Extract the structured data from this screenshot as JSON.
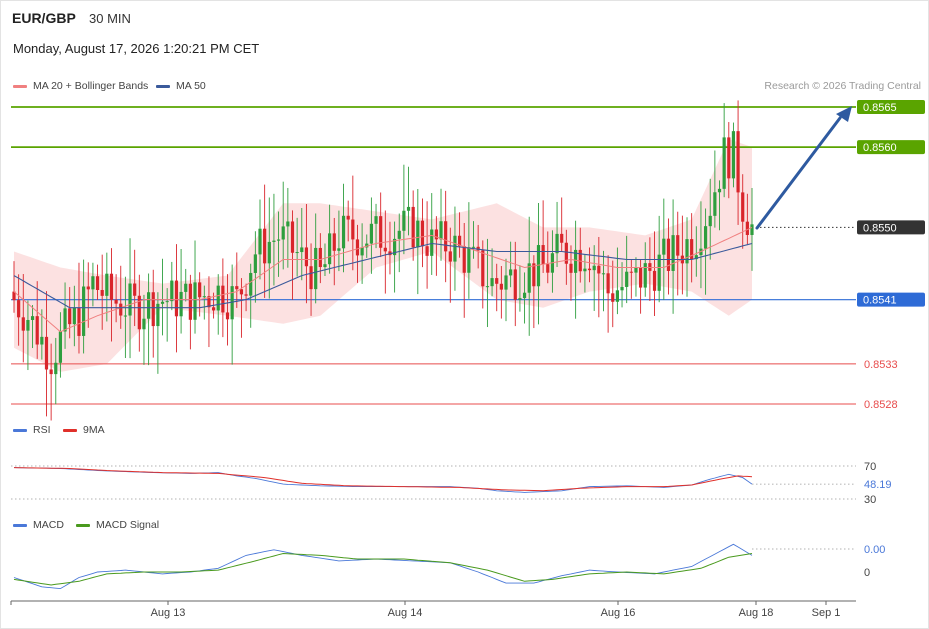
{
  "header": {
    "symbol": "EUR/GBP",
    "timeframe": "30 MIN",
    "datetime": "Monday, August 17, 2026 1:20:21 PM CET",
    "copyright": "Research © 2026 Trading Central"
  },
  "colors": {
    "bollinger_fill": "#fcdcdc",
    "ma20": "#f08080",
    "ma50": "#3a5a9b",
    "resistance": "#5aa400",
    "support_blue": "#2e6bd6",
    "support_red": "#e84c4c",
    "current": "#333333",
    "arrow": "#2e5aa0",
    "rsi": "#4a78d8",
    "rsi_ma": "#e0302a",
    "macd": "#4a78d8",
    "macd_signal": "#4a9a1e",
    "candle_up": "#2e9e3e",
    "candle_down": "#d9252b"
  },
  "chart_data": [
    {
      "type": "candlestick",
      "legend": [
        "MA 20 + Bollinger Bands",
        "MA 50"
      ],
      "ylim": [
        0.8522,
        0.8567
      ],
      "x_ticks": [
        "Aug 13",
        "Aug 14",
        "Aug 16",
        "Aug 18",
        "Sep 1"
      ],
      "levels": [
        {
          "label": "0.8565",
          "value": 0.8565,
          "kind": "resistance"
        },
        {
          "label": "0.8560",
          "value": 0.856,
          "kind": "resistance"
        },
        {
          "label": "0.8550",
          "value": 0.855,
          "kind": "current"
        },
        {
          "label": "0.8541",
          "value": 0.8541,
          "kind": "pivot"
        },
        {
          "label": "0.8533",
          "value": 0.8533,
          "kind": "support"
        },
        {
          "label": "0.8528",
          "value": 0.8528,
          "kind": "support"
        }
      ],
      "close_anchors": [
        [
          0,
          0.8541
        ],
        [
          3,
          0.8539
        ],
        [
          5,
          0.8537
        ],
        [
          8,
          0.8534
        ],
        [
          11,
          0.8537
        ],
        [
          14,
          0.8539
        ],
        [
          17,
          0.8543
        ],
        [
          21,
          0.8541
        ],
        [
          26,
          0.854
        ],
        [
          32,
          0.8541
        ],
        [
          38,
          0.8541
        ],
        [
          44,
          0.8542
        ],
        [
          48,
          0.8541
        ],
        [
          52,
          0.8547
        ],
        [
          57,
          0.8549
        ],
        [
          62,
          0.8546
        ],
        [
          66,
          0.8544
        ],
        [
          70,
          0.8549
        ],
        [
          78,
          0.8549
        ],
        [
          86,
          0.855
        ],
        [
          90,
          0.8548
        ],
        [
          94,
          0.8548
        ],
        [
          98,
          0.8546
        ],
        [
          103,
          0.8543
        ],
        [
          108,
          0.8544
        ],
        [
          114,
          0.8545
        ],
        [
          118,
          0.8547
        ],
        [
          124,
          0.8547
        ],
        [
          128,
          0.8542
        ],
        [
          133,
          0.8543
        ],
        [
          138,
          0.8545
        ],
        [
          143,
          0.8547
        ],
        [
          147,
          0.8549
        ],
        [
          150,
          0.8553
        ],
        [
          153,
          0.8559
        ],
        [
          155,
          0.8559
        ],
        [
          157,
          0.8553
        ],
        [
          159,
          0.855
        ]
      ],
      "ma20_anchors": [
        [
          0,
          0.8542
        ],
        [
          10,
          0.8537
        ],
        [
          18,
          0.8539
        ],
        [
          28,
          0.8541
        ],
        [
          40,
          0.8541
        ],
        [
          48,
          0.8542
        ],
        [
          58,
          0.8546
        ],
        [
          66,
          0.8546
        ],
        [
          78,
          0.8548
        ],
        [
          90,
          0.8549
        ],
        [
          100,
          0.8547
        ],
        [
          110,
          0.8545
        ],
        [
          120,
          0.8546
        ],
        [
          130,
          0.8545
        ],
        [
          140,
          0.8545
        ],
        [
          148,
          0.8547
        ],
        [
          159,
          0.855
        ]
      ],
      "ma50_anchors": [
        [
          0,
          0.8544
        ],
        [
          12,
          0.854
        ],
        [
          26,
          0.854
        ],
        [
          40,
          0.854
        ],
        [
          50,
          0.8541
        ],
        [
          62,
          0.8544
        ],
        [
          76,
          0.8546
        ],
        [
          90,
          0.8548
        ],
        [
          104,
          0.8547
        ],
        [
          118,
          0.8547
        ],
        [
          132,
          0.8546
        ],
        [
          146,
          0.8546
        ],
        [
          159,
          0.8548
        ]
      ],
      "band_anchors": [
        [
          0,
          0.8547,
          0.8535
        ],
        [
          10,
          0.8545,
          0.8532
        ],
        [
          20,
          0.8544,
          0.8533
        ],
        [
          32,
          0.8543,
          0.854
        ],
        [
          46,
          0.8544,
          0.8539
        ],
        [
          58,
          0.8553,
          0.8538
        ],
        [
          66,
          0.8553,
          0.8539
        ],
        [
          78,
          0.8552,
          0.8545
        ],
        [
          90,
          0.8551,
          0.8547
        ],
        [
          104,
          0.8553,
          0.8541
        ],
        [
          114,
          0.855,
          0.854
        ],
        [
          124,
          0.855,
          0.8542
        ],
        [
          136,
          0.8549,
          0.8543
        ],
        [
          146,
          0.8551,
          0.8542
        ],
        [
          154,
          0.8561,
          0.8539
        ],
        [
          159,
          0.856,
          0.8541
        ]
      ]
    },
    {
      "type": "line",
      "legend": [
        "RSI",
        "9MA"
      ],
      "y_ticks": [
        "70",
        "30"
      ],
      "current_label": "48.19",
      "ylim": [
        20,
        80
      ],
      "rsi_anchors": [
        [
          0,
          68
        ],
        [
          10,
          67
        ],
        [
          20,
          64
        ],
        [
          30,
          62
        ],
        [
          38,
          61
        ],
        [
          44,
          62
        ],
        [
          48,
          58
        ],
        [
          52,
          55
        ],
        [
          58,
          48
        ],
        [
          66,
          46
        ],
        [
          74,
          45
        ],
        [
          84,
          45
        ],
        [
          94,
          45
        ],
        [
          100,
          43
        ],
        [
          104,
          40
        ],
        [
          110,
          38
        ],
        [
          118,
          40
        ],
        [
          124,
          45
        ],
        [
          132,
          46
        ],
        [
          140,
          44
        ],
        [
          146,
          47
        ],
        [
          150,
          54
        ],
        [
          154,
          60
        ],
        [
          157,
          56
        ],
        [
          159,
          48
        ]
      ],
      "rsi_ma_anchors": [
        [
          0,
          68
        ],
        [
          12,
          67
        ],
        [
          22,
          64
        ],
        [
          32,
          62
        ],
        [
          44,
          61
        ],
        [
          54,
          56
        ],
        [
          62,
          49
        ],
        [
          72,
          46
        ],
        [
          84,
          45
        ],
        [
          96,
          44
        ],
        [
          106,
          41
        ],
        [
          114,
          40
        ],
        [
          122,
          43
        ],
        [
          132,
          45
        ],
        [
          140,
          45
        ],
        [
          146,
          47
        ],
        [
          152,
          54
        ],
        [
          156,
          58
        ],
        [
          159,
          57
        ]
      ]
    },
    {
      "type": "line",
      "legend": [
        "MACD",
        "MACD Signal"
      ],
      "y_ticks": [
        "0"
      ],
      "current_label": "0.00",
      "ylim": [
        -1.2,
        2.2
      ],
      "macd_anchors": [
        [
          0,
          -0.3
        ],
        [
          6,
          -0.8
        ],
        [
          10,
          -0.9
        ],
        [
          14,
          -0.3
        ],
        [
          18,
          0.0
        ],
        [
          24,
          0.1
        ],
        [
          32,
          -0.1
        ],
        [
          38,
          0.0
        ],
        [
          44,
          0.2
        ],
        [
          50,
          0.9
        ],
        [
          56,
          1.2
        ],
        [
          62,
          0.9
        ],
        [
          70,
          0.6
        ],
        [
          78,
          0.7
        ],
        [
          86,
          0.6
        ],
        [
          94,
          0.5
        ],
        [
          100,
          0.0
        ],
        [
          106,
          -0.6
        ],
        [
          112,
          -0.6
        ],
        [
          118,
          -0.2
        ],
        [
          124,
          0.1
        ],
        [
          130,
          0.0
        ],
        [
          138,
          -0.1
        ],
        [
          146,
          0.3
        ],
        [
          152,
          1.1
        ],
        [
          155,
          1.5
        ],
        [
          157,
          1.2
        ],
        [
          159,
          0.9
        ]
      ],
      "signal_anchors": [
        [
          0,
          -0.4
        ],
        [
          8,
          -0.7
        ],
        [
          14,
          -0.5
        ],
        [
          20,
          -0.1
        ],
        [
          28,
          0.0
        ],
        [
          36,
          0.0
        ],
        [
          44,
          0.1
        ],
        [
          52,
          0.6
        ],
        [
          58,
          1.0
        ],
        [
          66,
          0.9
        ],
        [
          74,
          0.7
        ],
        [
          84,
          0.7
        ],
        [
          94,
          0.5
        ],
        [
          102,
          0.1
        ],
        [
          110,
          -0.5
        ],
        [
          116,
          -0.4
        ],
        [
          124,
          -0.1
        ],
        [
          132,
          0.0
        ],
        [
          140,
          -0.1
        ],
        [
          148,
          0.2
        ],
        [
          154,
          0.8
        ],
        [
          159,
          1.0
        ]
      ]
    }
  ]
}
